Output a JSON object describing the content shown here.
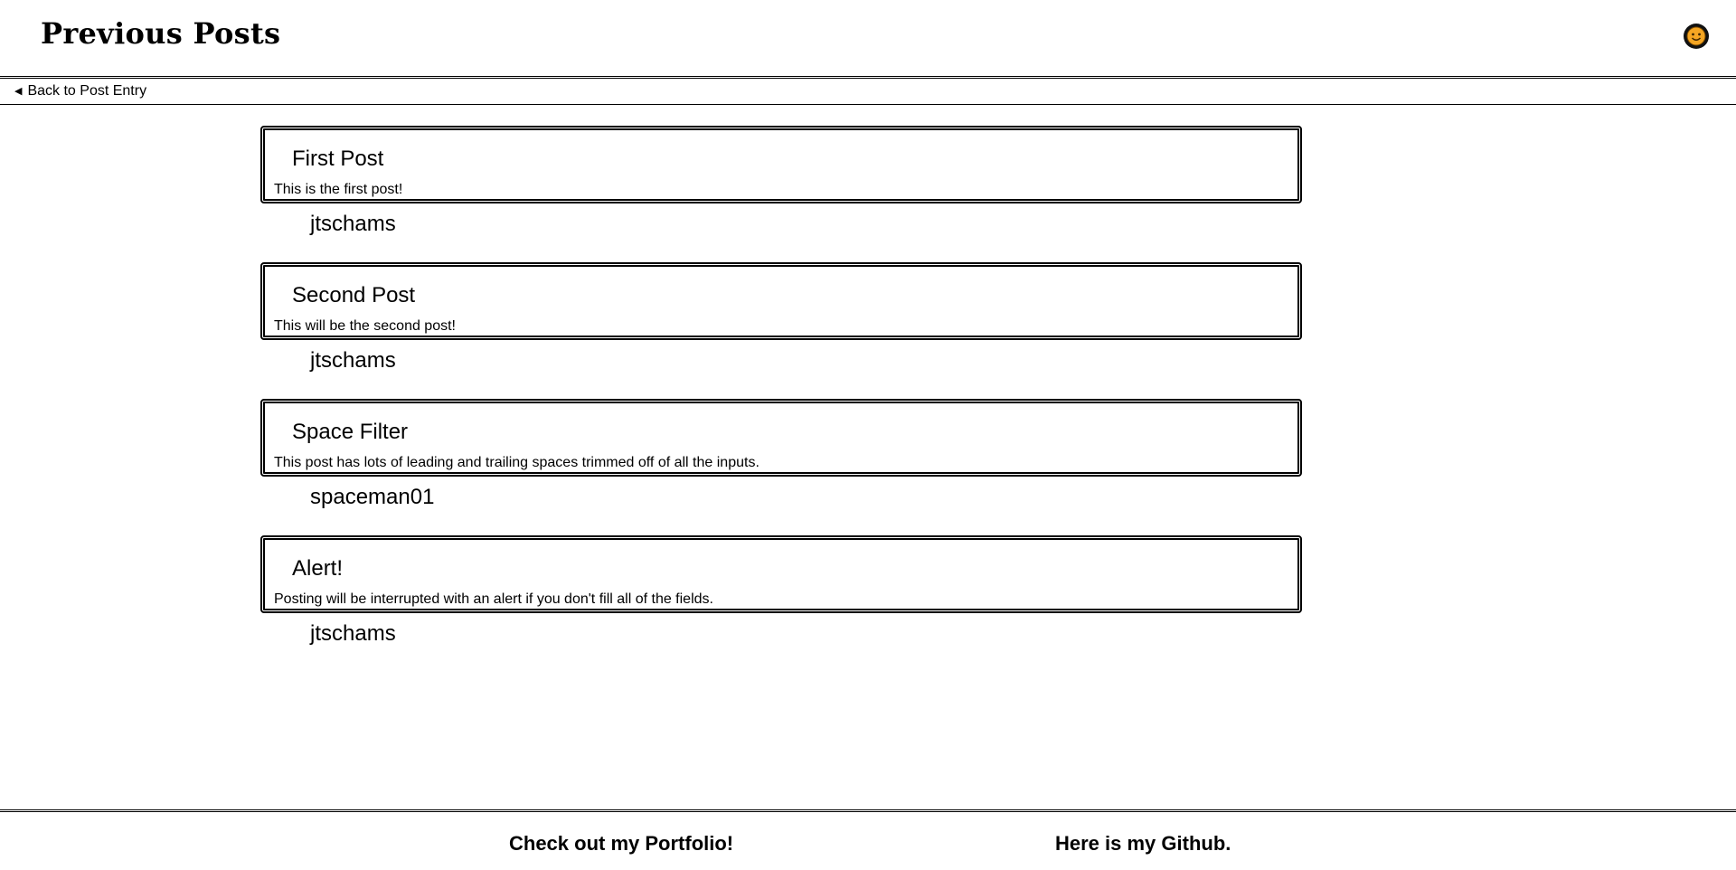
{
  "header": {
    "title": "Previous Posts",
    "avatar_icon": "smiley-avatar-icon"
  },
  "nav": {
    "back_icon": "chevron-left-icon",
    "back_label": "Back to Post Entry"
  },
  "posts": [
    {
      "title": "First Post",
      "body": "This is the first post!",
      "author": "jtschams"
    },
    {
      "title": "Second Post",
      "body": "This will be the second post!",
      "author": "jtschams"
    },
    {
      "title": "Space Filter",
      "body": "This post has lots of leading and trailing spaces trimmed off of all the inputs.",
      "author": "spaceman01"
    },
    {
      "title": "Alert!",
      "body": "Posting will be interrupted with an alert if you don't fill all of the fields.",
      "author": "jtschams"
    }
  ],
  "footer": {
    "portfolio_label": "Check out my Portfolio!",
    "github_label": "Here is my Github."
  },
  "colors": {
    "background": "#ffffff",
    "text": "#000000",
    "avatar_face": "#f5a623"
  }
}
